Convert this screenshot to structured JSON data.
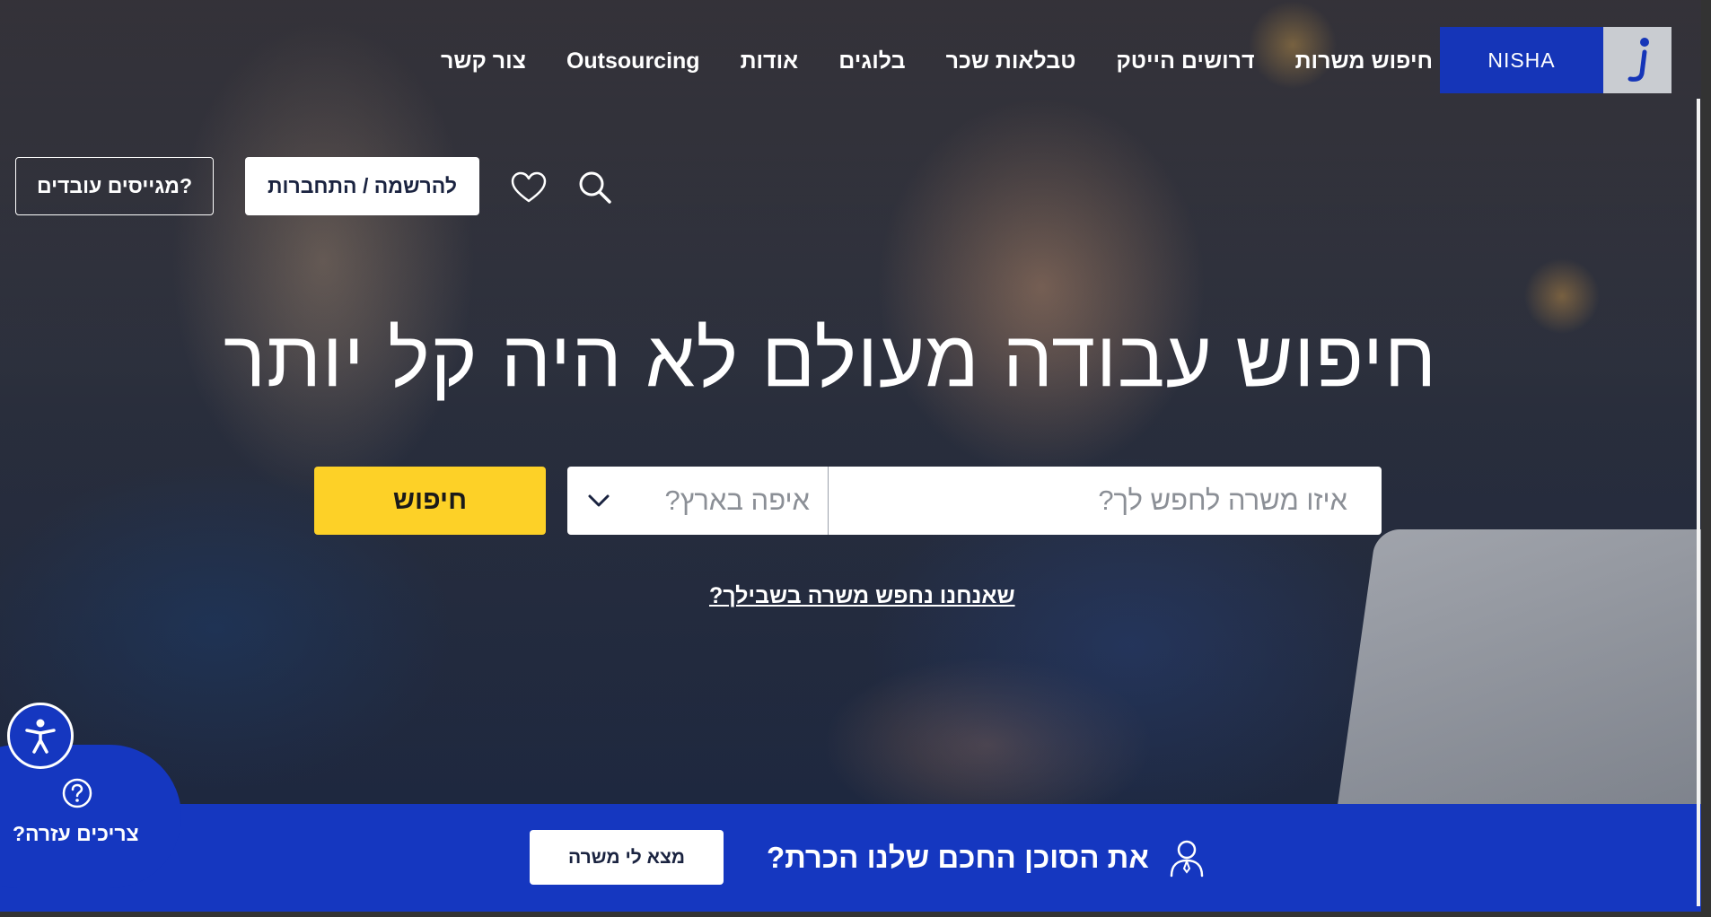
{
  "brand": {
    "name": "NISHA",
    "accent": "#1535b8",
    "cta_yellow": "#fdd127"
  },
  "nav": {
    "items": [
      {
        "label": "חיפוש משרות"
      },
      {
        "label": "דרושים הייטק"
      },
      {
        "label": "טבלאות שכר"
      },
      {
        "label": "בלוגים"
      },
      {
        "label": "אודות"
      },
      {
        "label": "Outsourcing"
      },
      {
        "label": "צור קשר"
      }
    ]
  },
  "header": {
    "employers_label": "מגייסים עובדים?",
    "login_label": "להרשמה / התחברות",
    "favorites_icon": "heart-icon",
    "search_icon": "search-icon"
  },
  "hero": {
    "headline": "חיפוש עבודה מעולם לא היה קל יותר",
    "job_placeholder": "איזו משרה לחפש לך?",
    "location_placeholder": "איפה בארץ?",
    "search_button": "חיפוש",
    "helper_link": "שאנחנו נחפש משרה בשבילך?"
  },
  "agent_bar": {
    "text": "את הסוכן החכם שלנו הכרת?",
    "button": "מצא לי משרה",
    "icon": "user-icon"
  },
  "help_widget": {
    "label": "צריכים עזרה?",
    "icon": "question-icon"
  },
  "accessibility": {
    "icon": "accessibility-icon"
  }
}
